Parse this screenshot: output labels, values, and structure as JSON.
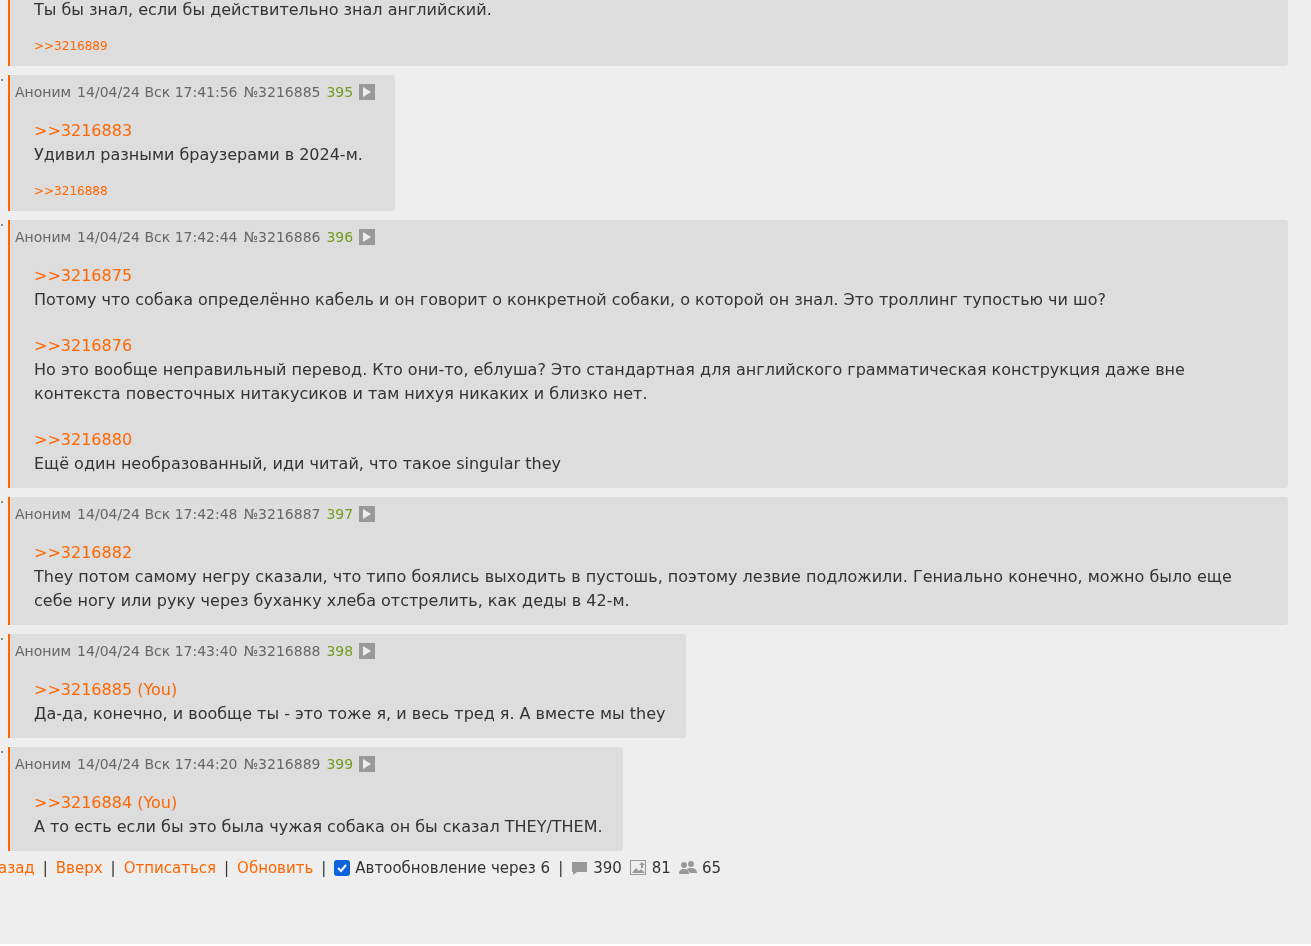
{
  "posts": [
    {
      "blocks": [
        {
          "text": "Ты бы знал, если бы действительно знал английский."
        }
      ],
      "replies": [
        ">>3216889"
      ]
    },
    {
      "header": {
        "name": "Аноним",
        "date": "14/04/24 Вск 17:41:56",
        "number": "№3216885",
        "index": "395"
      },
      "blocks": [
        {
          "quote": ">>3216883",
          "text": "Удивил разными браузерами в 2024-м."
        }
      ],
      "replies": [
        ">>3216888"
      ]
    },
    {
      "header": {
        "name": "Аноним",
        "date": "14/04/24 Вск 17:42:44",
        "number": "№3216886",
        "index": "396"
      },
      "blocks": [
        {
          "quote": ">>3216875",
          "text": "Потому что собака определённо кабель и он говорит о конкретной собаки, о которой он знал. Это троллинг тупостью чи шо?"
        },
        {
          "quote": ">>3216876",
          "text": "Но это вообще неправильный перевод. Кто они-то, еблуша? Это стандартная для английского грамматическая конструкция даже вне контекста повесточных нитакусиков и там нихуя никаких и близко нет."
        },
        {
          "quote": ">>3216880",
          "text": "Ещё один необразованный, иди читай, что такое singular they"
        }
      ]
    },
    {
      "header": {
        "name": "Аноним",
        "date": "14/04/24 Вск 17:42:48",
        "number": "№3216887",
        "index": "397"
      },
      "blocks": [
        {
          "quote": ">>3216882",
          "text": "They потом самому негру сказали, что типо боялись выходить в пустошь, поэтому лезвие подложили. Гениально конечно, можно было еще себе ногу или руку через буханку хлеба отстрелить, как деды в 42-м."
        }
      ]
    },
    {
      "header": {
        "name": "Аноним",
        "date": "14/04/24 Вск 17:43:40",
        "number": "№3216888",
        "index": "398"
      },
      "blocks": [
        {
          "quote": ">>3216885 (You)",
          "text": "Да-да, конечно, и вообще ты - это тоже я, и весь тред я. А вместе мы they"
        }
      ]
    },
    {
      "header": {
        "name": "Аноним",
        "date": "14/04/24 Вск 17:44:20",
        "number": "№3216889",
        "index": "399"
      },
      "blocks": [
        {
          "quote": ">>3216884 (You)",
          "text": "А то есть если бы это была чужая собака он бы сказал THEY/THEM."
        }
      ]
    }
  ],
  "footer": [
    {
      "kind": "link",
      "text": "азад"
    },
    {
      "kind": "separator",
      "text": "|"
    },
    {
      "kind": "link",
      "text": "Вверх"
    },
    {
      "kind": "separator",
      "text": "|"
    },
    {
      "kind": "link",
      "text": "Отписаться"
    },
    {
      "kind": "separator",
      "text": "|"
    },
    {
      "kind": "link",
      "text": "Обновить"
    },
    {
      "kind": "separator",
      "text": "|"
    },
    {
      "kind": "checkbox",
      "text": "Автообновление через 6",
      "checked": true
    },
    {
      "kind": "separator",
      "text": "|"
    },
    {
      "kind": "posts",
      "text": "390"
    },
    {
      "kind": "images",
      "text": "81"
    },
    {
      "kind": "posters",
      "text": "65"
    }
  ]
}
